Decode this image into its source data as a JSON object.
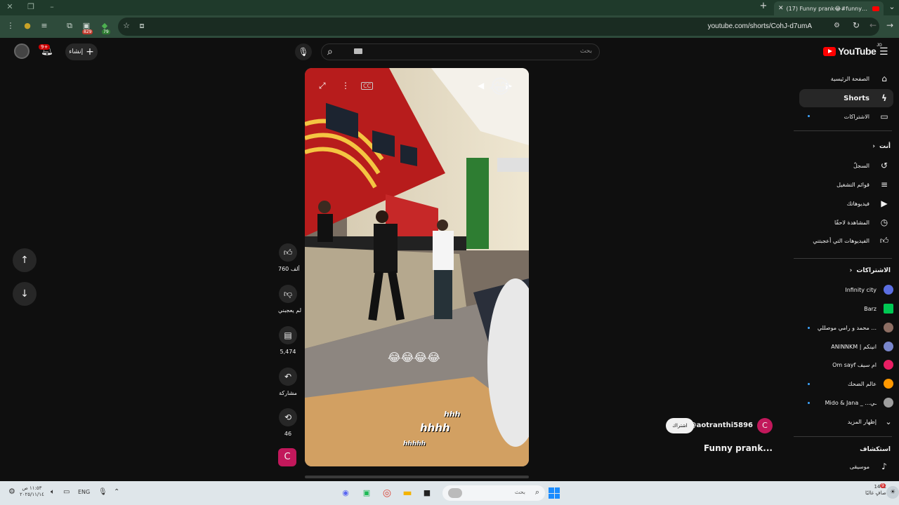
{
  "browser": {
    "tab_title": "(17) Funny prank😂#funny#pr",
    "url": "youtube.com/shorts/CohJ-d7umA",
    "ext_badge_1": "829",
    "ext_badge_2": "79"
  },
  "header": {
    "logo_text": "YouTube",
    "logo_region": "JO",
    "search_placeholder": "بحث",
    "create_label": "إنشاء",
    "notif_count": "9+"
  },
  "sidebar": {
    "main": [
      {
        "label": "الصفحة الرئيسية",
        "icon": "home-icon"
      },
      {
        "label": "Shorts",
        "icon": "shorts-icon"
      },
      {
        "label": "الاشتراكات",
        "icon": "subscriptions-icon"
      }
    ],
    "you_heading": "أنت",
    "you": [
      {
        "label": "السجلّ",
        "icon": "history-icon"
      },
      {
        "label": "قوائم التشغيل",
        "icon": "playlists-icon"
      },
      {
        "label": "فيديوهاتك",
        "icon": "your-videos-icon"
      },
      {
        "label": "المشاهدة لاحقًا",
        "icon": "watch-later-icon"
      },
      {
        "label": "الفيديوهات التي أعجبتني",
        "icon": "liked-videos-icon"
      }
    ],
    "subs_heading": "الاشتراكات",
    "subs": [
      {
        "label": "Infinity city",
        "color": "#5b6ee1"
      },
      {
        "label": "Barz",
        "color": "#00c853"
      },
      {
        "label": "محمد و رامي موصللي ...",
        "color": "#8d6e63"
      },
      {
        "label": "ANINNKM | انينكم",
        "color": "#7986cb"
      },
      {
        "label": "Om sayf ام سيف",
        "color": "#e91e63"
      },
      {
        "label": "عالم الضحك",
        "color": "#ff9800"
      },
      {
        "label": "Mido & Jana _ ...ـي",
        "color": "#9e9e9e"
      }
    ],
    "show_more": "إظهار المزيد",
    "explore_heading": "استكشاف",
    "explore": [
      {
        "label": "موسيقى",
        "icon": "music-icon"
      }
    ]
  },
  "short": {
    "likes": "760 ألف",
    "dislike_label": "لم يعجبني",
    "comments": "5,474",
    "share_label": "مشاركة",
    "remix_count": "46",
    "channel_initial": "C",
    "channel_name": "@aotranthi5896",
    "subscribe_label": "اشتراك",
    "title": "Funny prank...",
    "emoji_caption": "😂😂😂😂",
    "overlay_text_1": "hhh",
    "overlay_text_2": "hhhh",
    "overlay_text_3": "hhhhh",
    "overlay_emoji": "😂"
  },
  "taskbar": {
    "search_placeholder": "بحث",
    "language": "ENG",
    "time": "١١:٥٣ ص",
    "date": "٢٠٢٥/١١/١٤",
    "weather_temp": "14°C",
    "weather_desc": "صافٍ غالبًا",
    "notif_count": "9"
  }
}
